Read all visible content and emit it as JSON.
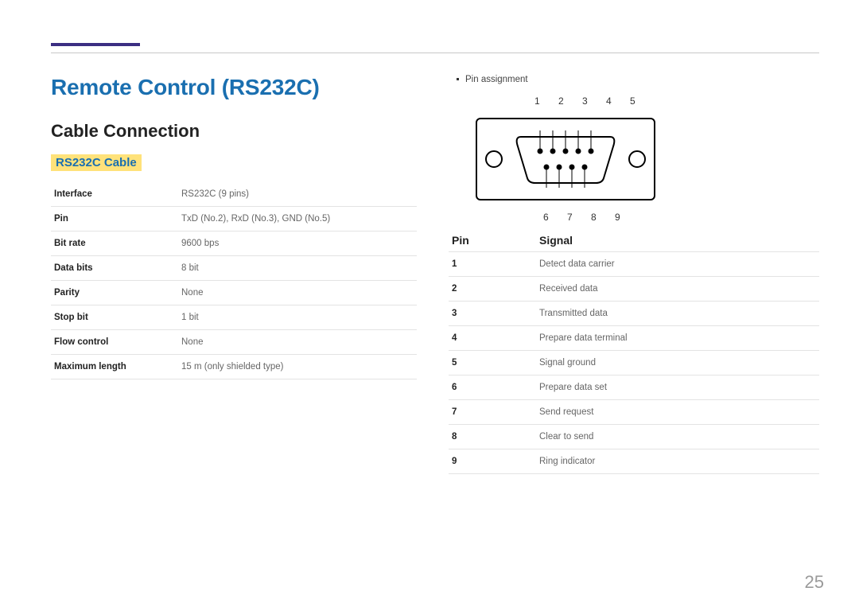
{
  "page_number": "25",
  "title": "Remote Control (RS232C)",
  "subtitle": "Cable Connection",
  "section_label": "RS232C Cable",
  "spec": [
    {
      "k": "Interface",
      "v": "RS232C (9 pins)"
    },
    {
      "k": "Pin",
      "v": "TxD (No.2), RxD (No.3), GND (No.5)"
    },
    {
      "k": "Bit rate",
      "v": "9600 bps"
    },
    {
      "k": "Data bits",
      "v": "8 bit"
    },
    {
      "k": "Parity",
      "v": "None"
    },
    {
      "k": "Stop bit",
      "v": "1 bit"
    },
    {
      "k": "Flow control",
      "v": "None"
    },
    {
      "k": "Maximum length",
      "v": "15 m (only shielded type)"
    }
  ],
  "right_bullet": "Pin assignment",
  "pin_labels_top": "1 2 3 4 5",
  "pin_labels_bottom": "6 7 8 9",
  "signal_header": {
    "pin": "Pin",
    "signal": "Signal"
  },
  "signals": [
    {
      "pin": "1",
      "signal": "Detect data carrier"
    },
    {
      "pin": "2",
      "signal": "Received data"
    },
    {
      "pin": "3",
      "signal": "Transmitted data"
    },
    {
      "pin": "4",
      "signal": "Prepare data terminal"
    },
    {
      "pin": "5",
      "signal": "Signal ground"
    },
    {
      "pin": "6",
      "signal": "Prepare data set"
    },
    {
      "pin": "7",
      "signal": "Send request"
    },
    {
      "pin": "8",
      "signal": "Clear to send"
    },
    {
      "pin": "9",
      "signal": "Ring indicator"
    }
  ]
}
